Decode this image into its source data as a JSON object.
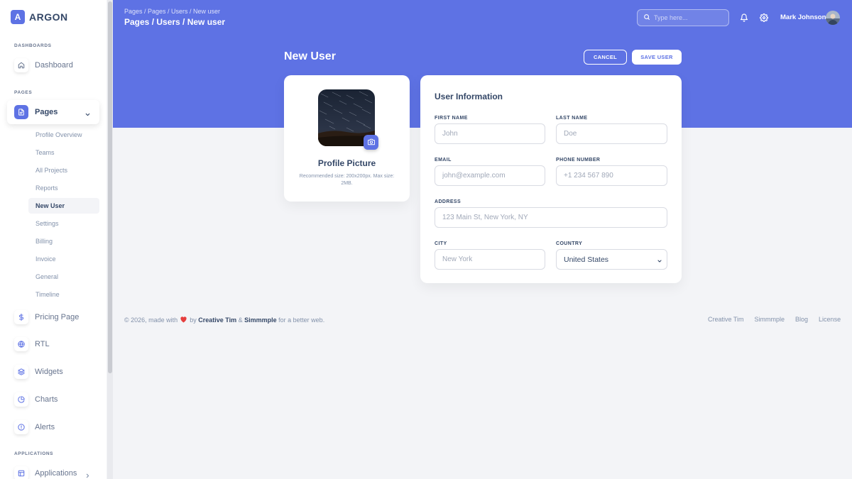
{
  "brand": {
    "logo_letter": "A",
    "name": "ARGON"
  },
  "sidebar": {
    "sections": {
      "dashboards": "DASHBOARDS",
      "pages": "PAGES",
      "applications": "APPLICATIONS"
    },
    "items": {
      "dashboard": {
        "label": "Dashboard",
        "icon": "home-icon"
      },
      "pages": {
        "label": "Pages",
        "icon": "document-icon",
        "expanded": true
      },
      "pricing": {
        "label": "Pricing Page",
        "icon": "dollar-icon"
      },
      "rtl": {
        "label": "RTL",
        "icon": "globe-icon"
      },
      "widgets": {
        "label": "Widgets",
        "icon": "layers-icon"
      },
      "charts": {
        "label": "Charts",
        "icon": "pie-chart-icon"
      },
      "alerts": {
        "label": "Alerts",
        "icon": "alert-icon"
      },
      "applications": {
        "label": "Applications",
        "icon": "table-icon"
      }
    },
    "subitems": [
      "Profile Overview",
      "Teams",
      "All Projects",
      "Reports",
      "New User",
      "Settings",
      "Billing",
      "Invoice",
      "General",
      "Timeline"
    ],
    "active_subitem": "New User"
  },
  "header": {
    "breadcrumb_small": "Pages  /  Pages / Users / New user",
    "breadcrumb_big": "Pages / Users / New user",
    "search_placeholder": "Type here...",
    "user_name": "Mark Johnson"
  },
  "page": {
    "title": "New User",
    "cancel_label": "CANCEL",
    "save_label": "SAVE USER"
  },
  "profile_card": {
    "title": "Profile Picture",
    "note": "Recommended size: 200x200px. Max size: 2MB."
  },
  "info_card": {
    "title": "User Information",
    "fields": {
      "first_name": {
        "label": "FIRST NAME",
        "placeholder": "John"
      },
      "last_name": {
        "label": "LAST NAME",
        "placeholder": "Doe"
      },
      "email": {
        "label": "EMAIL",
        "placeholder": "john@example.com"
      },
      "phone": {
        "label": "PHONE NUMBER",
        "placeholder": "+1 234 567 890"
      },
      "address": {
        "label": "ADDRESS",
        "placeholder": "123 Main St, New York, NY"
      },
      "city": {
        "label": "CITY",
        "placeholder": "New York"
      },
      "country": {
        "label": "COUNTRY",
        "value": "United States"
      }
    }
  },
  "footer": {
    "copyright_prefix": "© 2026, made with",
    "by": "by",
    "author1": "Creative Tim",
    "amp": "&",
    "author2": "Simmmple",
    "suffix": "for a better web.",
    "links": [
      "Creative Tim",
      "Simmmple",
      "Blog",
      "License"
    ]
  },
  "colors": {
    "primary": "#5e72e4",
    "text_dark": "#344767",
    "text_muted": "#8392ab",
    "heart": "#e53e3e"
  }
}
